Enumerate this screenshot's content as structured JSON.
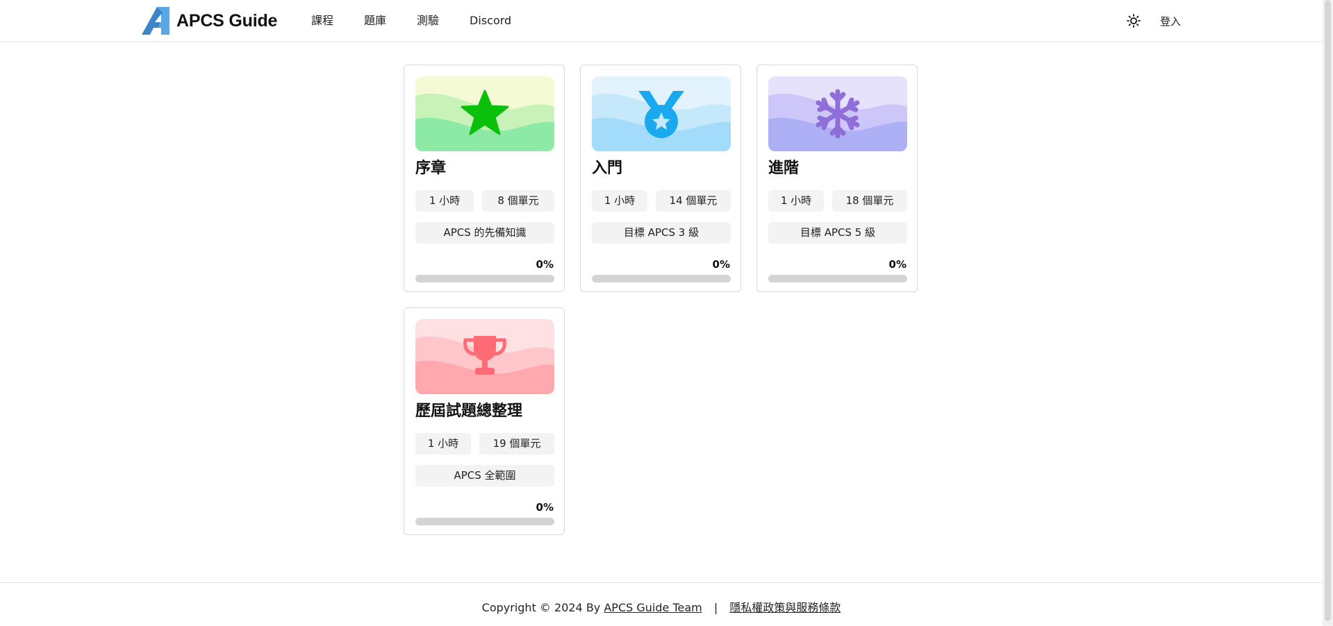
{
  "header": {
    "brand_name": "APCS Guide",
    "nav": [
      {
        "label": "課程"
      },
      {
        "label": "題庫"
      },
      {
        "label": "測驗"
      },
      {
        "label": "Discord"
      }
    ],
    "theme_icon": "sun-icon",
    "login_label": "登入"
  },
  "courses": [
    {
      "title": "序章",
      "duration": "1 小時",
      "units": "8 個單元",
      "goal": "APCS 的先備知識",
      "progress_label": "0%",
      "progress": 0,
      "icon": "star-icon",
      "icon_color": "#0bbf0b",
      "banner_colors": [
        "#f4fbd4",
        "#c8f2b8",
        "#8deaa6"
      ]
    },
    {
      "title": "入門",
      "duration": "1 小時",
      "units": "14 個單元",
      "goal": "目標 APCS 3 級",
      "progress_label": "0%",
      "progress": 0,
      "icon": "medal-icon",
      "icon_color": "#1aa8ef",
      "banner_colors": [
        "#e2f3fd",
        "#c5e8fb",
        "#a3dbfa"
      ]
    },
    {
      "title": "進階",
      "duration": "1 小時",
      "units": "18 個單元",
      "goal": "目標 APCS 5 級",
      "progress_label": "0%",
      "progress": 0,
      "icon": "snowflake-icon",
      "icon_color": "#8f6ed8",
      "banner_colors": [
        "#e6e2fb",
        "#cdc6f8",
        "#aeb0f6"
      ]
    },
    {
      "title": "歷屆試題總整理",
      "duration": "1 小時",
      "units": "19 個單元",
      "goal": "APCS 全範圍",
      "progress_label": "0%",
      "progress": 0,
      "icon": "trophy-icon",
      "icon_color": "#ff6b74",
      "banner_colors": [
        "#ffe1e3",
        "#ffc7ca",
        "#ffa8ad"
      ]
    }
  ],
  "footer": {
    "copyright": "Copyright © 2024 By",
    "team_link": "APCS Guide Team",
    "separator": "|",
    "policy_link": "隱私權政策與服務條款"
  }
}
